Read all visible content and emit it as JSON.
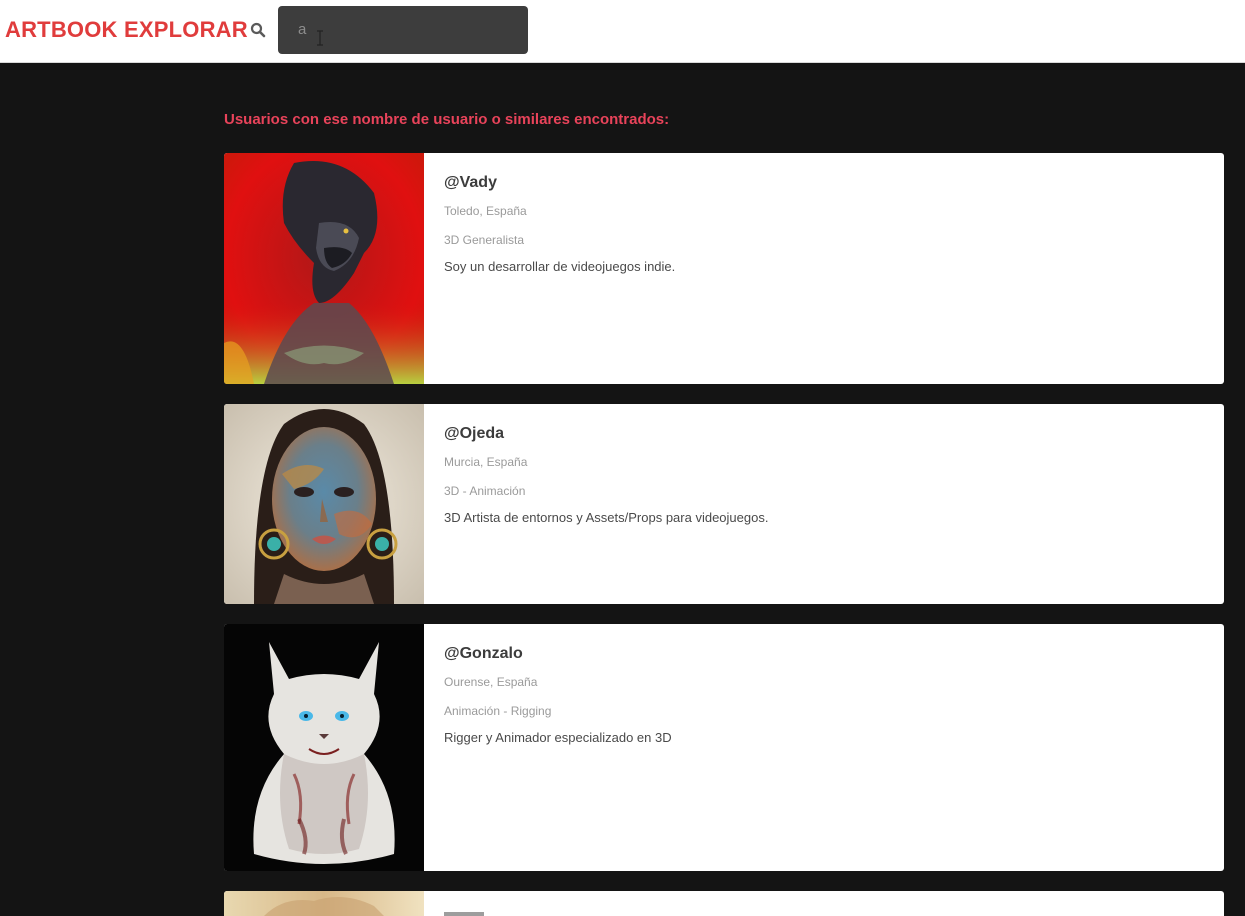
{
  "header": {
    "brand_label": "ARTBOOK",
    "explore_label": "EXPLORAR",
    "search_value": "a",
    "accent_color": "#e03c3c"
  },
  "results": {
    "heading": "Usuarios con ese nombre de usuario o similares encontrados:",
    "users": [
      {
        "username": "@Vady",
        "location": "Toledo, España",
        "specialty": "3D Generalista",
        "bio": "Soy un desarrollar de videojuegos indie."
      },
      {
        "username": "@Ojeda",
        "location": "Murcia, España",
        "specialty": "3D - Animación",
        "bio": "3D Artista de entornos y Assets/Props para videojuegos."
      },
      {
        "username": "@Gonzalo",
        "location": "Ourense, España",
        "specialty": "Animación - Rigging",
        "bio": "Rigger y Animador especializado en 3D"
      }
    ]
  }
}
